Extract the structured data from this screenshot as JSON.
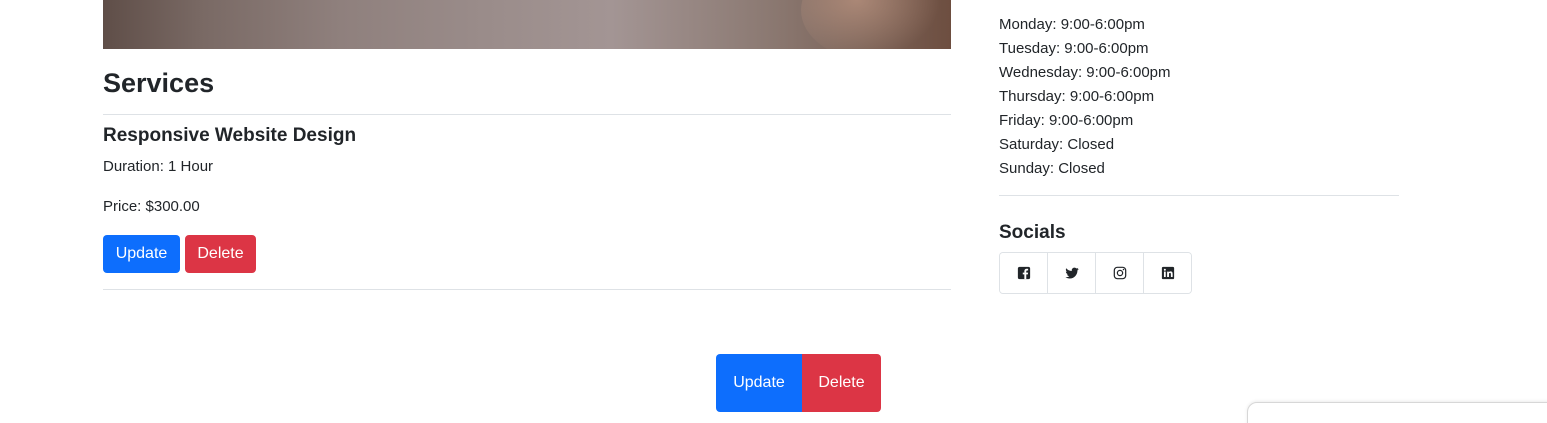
{
  "services": {
    "title": "Services",
    "items": [
      {
        "name": "Responsive Website Design",
        "duration": "Duration: 1 Hour",
        "price": "Price: $300.00",
        "update_label": "Update",
        "delete_label": "Delete"
      }
    ],
    "footer_actions": {
      "update_label": "Update",
      "delete_label": "Delete"
    }
  },
  "sidebar": {
    "hours": [
      "Monday: 9:00-6:00pm",
      "Tuesday: 9:00-6:00pm",
      "Wednesday: 9:00-6:00pm",
      "Thursday: 9:00-6:00pm",
      "Friday: 9:00-6:00pm",
      "Saturday: Closed",
      "Sunday: Closed"
    ],
    "socials_title": "Socials",
    "socials": [
      {
        "icon": "facebook-icon"
      },
      {
        "icon": "twitter-icon"
      },
      {
        "icon": "instagram-icon"
      },
      {
        "icon": "linkedin-icon"
      }
    ]
  },
  "colors": {
    "primary": "#0d6efd",
    "danger": "#dc3545",
    "text": "#212529",
    "divider": "#dee2e6"
  }
}
